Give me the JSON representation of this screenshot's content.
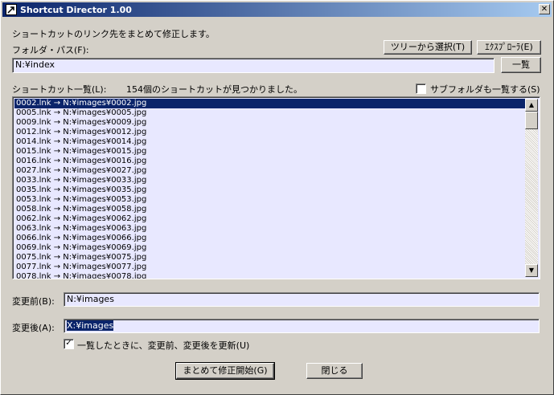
{
  "window": {
    "title": "Shortcut Director 1.00",
    "close_glyph": "✕"
  },
  "description": "ショートカットのリンク先をまとめて修正します。",
  "folder": {
    "label": "フォルダ・パス(F):",
    "value": "N:¥index",
    "tree_button": "ツリーから選択(T)",
    "explorer_button": "ｴｸｽﾌﾟﾛｰﾗ(E)",
    "list_button": "一覧"
  },
  "shortcuts": {
    "label": "ショートカット一覧(L):",
    "count_text": "154個のショートカットが見つかりました。",
    "subfolder_label": "サブフォルダも一覧する(S)",
    "subfolder_checked": false,
    "items": [
      "0002.lnk → N:¥images¥0002.jpg",
      "0005.lnk → N:¥images¥0005.jpg",
      "0009.lnk → N:¥images¥0009.jpg",
      "0012.lnk → N:¥images¥0012.jpg",
      "0014.lnk → N:¥images¥0014.jpg",
      "0015.lnk → N:¥images¥0015.jpg",
      "0016.lnk → N:¥images¥0016.jpg",
      "0027.lnk → N:¥images¥0027.jpg",
      "0033.lnk → N:¥images¥0033.jpg",
      "0035.lnk → N:¥images¥0035.jpg",
      "0053.lnk → N:¥images¥0053.jpg",
      "0058.lnk → N:¥images¥0058.jpg",
      "0062.lnk → N:¥images¥0062.jpg",
      "0063.lnk → N:¥images¥0063.jpg",
      "0066.lnk → N:¥images¥0066.jpg",
      "0069.lnk → N:¥images¥0069.jpg",
      "0075.lnk → N:¥images¥0075.jpg",
      "0077.lnk → N:¥images¥0077.jpg",
      "0078.lnk → N:¥images¥0078.jpg"
    ],
    "selected_index": 0
  },
  "before": {
    "label": "変更前(B):",
    "value": "N:¥images"
  },
  "after": {
    "label": "変更後(A):",
    "value": "X:¥images"
  },
  "update_option": {
    "label": "一覧したときに、変更前、変更後を更新(U)",
    "checked": true,
    "check_glyph": "✓"
  },
  "actions": {
    "start_button": "まとめて修正開始(G)",
    "close_button": "閉じる"
  },
  "scrollbar": {
    "up_glyph": "▲",
    "down_glyph": "▼"
  }
}
